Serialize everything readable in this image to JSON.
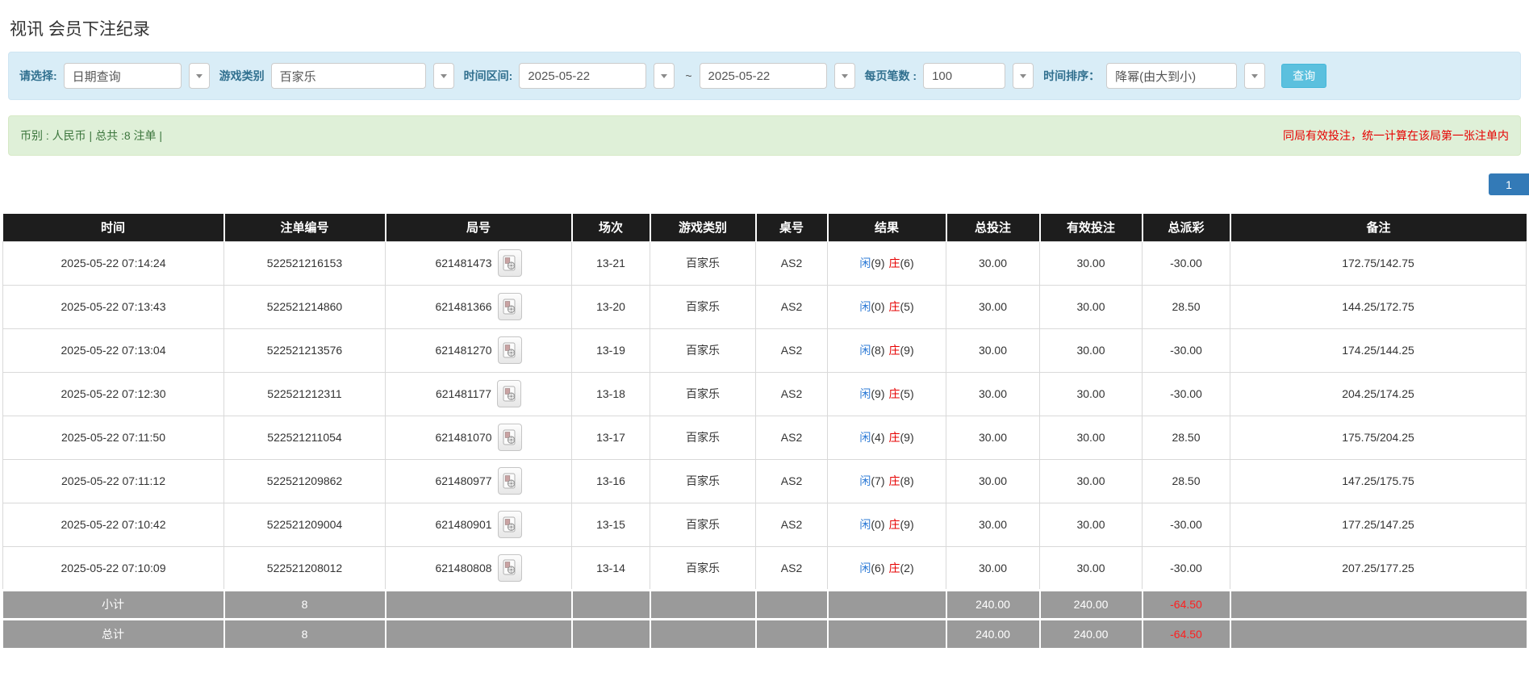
{
  "page": {
    "title": "视讯 会员下注纪录"
  },
  "filters": {
    "query_type": {
      "label": "请选择:",
      "value": "日期查询"
    },
    "game_category": {
      "label": "游戏类别",
      "value": "百家乐"
    },
    "date_range": {
      "label": "时间区间:",
      "from": "2025-05-22",
      "separator": "~",
      "to": "2025-05-22"
    },
    "page_size": {
      "label": "每页笔数 :",
      "value": "100"
    },
    "time_sort": {
      "label": "时间排序：",
      "value": "降幂(由大到小)"
    },
    "search_button": "查询"
  },
  "summary": {
    "left": "币别 : 人民币 | 总共 :8 注单 |",
    "notice": "同局有效投注，统一计算在该局第一张注单内"
  },
  "pagination": {
    "current": "1"
  },
  "table": {
    "headers": [
      "时间",
      "注单编号",
      "局号",
      "场次",
      "游戏类别",
      "桌号",
      "结果",
      "总投注",
      "有效投注",
      "总派彩",
      "备注"
    ],
    "rows": [
      {
        "time": "2025-05-22 07:14:24",
        "bet_id": "522521216153",
        "round_id": "621481473",
        "session": "13-21",
        "game": "百家乐",
        "table_no": "AS2",
        "player": "闲",
        "player_score": "(9)",
        "banker": "庄",
        "banker_score": "(6)",
        "total_bet": "30.00",
        "valid_bet": "30.00",
        "payout": "-30.00",
        "remark": "172.75/142.75"
      },
      {
        "time": "2025-05-22 07:13:43",
        "bet_id": "522521214860",
        "round_id": "621481366",
        "session": "13-20",
        "game": "百家乐",
        "table_no": "AS2",
        "player": "闲",
        "player_score": "(0)",
        "banker": "庄",
        "banker_score": "(5)",
        "total_bet": "30.00",
        "valid_bet": "30.00",
        "payout": "28.50",
        "remark": "144.25/172.75"
      },
      {
        "time": "2025-05-22 07:13:04",
        "bet_id": "522521213576",
        "round_id": "621481270",
        "session": "13-19",
        "game": "百家乐",
        "table_no": "AS2",
        "player": "闲",
        "player_score": "(8)",
        "banker": "庄",
        "banker_score": "(9)",
        "total_bet": "30.00",
        "valid_bet": "30.00",
        "payout": "-30.00",
        "remark": "174.25/144.25"
      },
      {
        "time": "2025-05-22 07:12:30",
        "bet_id": "522521212311",
        "round_id": "621481177",
        "session": "13-18",
        "game": "百家乐",
        "table_no": "AS2",
        "player": "闲",
        "player_score": "(9)",
        "banker": "庄",
        "banker_score": "(5)",
        "total_bet": "30.00",
        "valid_bet": "30.00",
        "payout": "-30.00",
        "remark": "204.25/174.25"
      },
      {
        "time": "2025-05-22 07:11:50",
        "bet_id": "522521211054",
        "round_id": "621481070",
        "session": "13-17",
        "game": "百家乐",
        "table_no": "AS2",
        "player": "闲",
        "player_score": "(4)",
        "banker": "庄",
        "banker_score": "(9)",
        "total_bet": "30.00",
        "valid_bet": "30.00",
        "payout": "28.50",
        "remark": "175.75/204.25"
      },
      {
        "time": "2025-05-22 07:11:12",
        "bet_id": "522521209862",
        "round_id": "621480977",
        "session": "13-16",
        "game": "百家乐",
        "table_no": "AS2",
        "player": "闲",
        "player_score": "(7)",
        "banker": "庄",
        "banker_score": "(8)",
        "total_bet": "30.00",
        "valid_bet": "30.00",
        "payout": "28.50",
        "remark": "147.25/175.75"
      },
      {
        "time": "2025-05-22 07:10:42",
        "bet_id": "522521209004",
        "round_id": "621480901",
        "session": "13-15",
        "game": "百家乐",
        "table_no": "AS2",
        "player": "闲",
        "player_score": "(0)",
        "banker": "庄",
        "banker_score": "(9)",
        "total_bet": "30.00",
        "valid_bet": "30.00",
        "payout": "-30.00",
        "remark": "177.25/147.25"
      },
      {
        "time": "2025-05-22 07:10:09",
        "bet_id": "522521208012",
        "round_id": "621480808",
        "session": "13-14",
        "game": "百家乐",
        "table_no": "AS2",
        "player": "闲",
        "player_score": "(6)",
        "banker": "庄",
        "banker_score": "(2)",
        "total_bet": "30.00",
        "valid_bet": "30.00",
        "payout": "-30.00",
        "remark": "207.25/177.25"
      }
    ],
    "subtotal": {
      "label": "小计",
      "count": "8",
      "total_bet": "240.00",
      "valid_bet": "240.00",
      "payout": "-64.50"
    },
    "grand_total": {
      "label": "总计",
      "count": "8",
      "total_bet": "240.00",
      "valid_bet": "240.00",
      "payout": "-64.50"
    }
  },
  "colors": {
    "accent": "#5bc0de",
    "filter_bg": "#d9edf7",
    "summary_bg": "#dff0d8",
    "summary_text": "#3c763d",
    "notice_red": "#e60000",
    "link_blue": "#337ab7",
    "player_blue": "#2e7bd6",
    "banker_red": "#e60000",
    "negative_red": "#f00000",
    "table_header_bg": "#1d1d1d",
    "total_row_bg": "#9a9a9a",
    "pagination_active": "#337ab7"
  }
}
